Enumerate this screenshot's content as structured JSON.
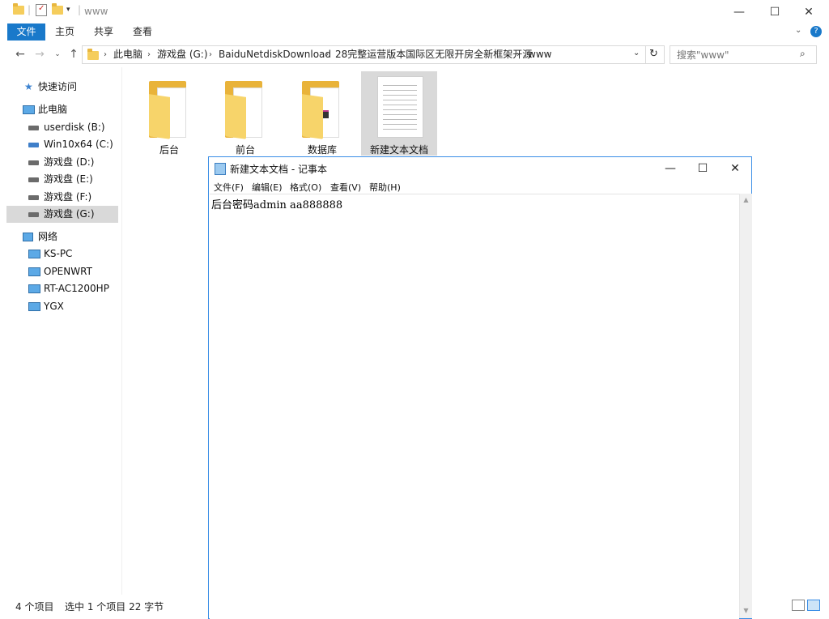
{
  "explorer": {
    "window_title": "www",
    "window_controls": {
      "minimize": "—",
      "maximize": "☐",
      "close": "✕"
    },
    "ribbon_tabs": [
      "文件",
      "主页",
      "共享",
      "查看"
    ],
    "breadcrumbs": [
      "此电脑",
      "游戏盘 (G:)",
      "BaiduNetdiskDownload",
      "28完整运营版本国际区无限开房全新框架开源",
      "www"
    ],
    "search_placeholder": "搜索\"www\"",
    "nav": {
      "quick_access": "快速访问",
      "this_pc": "此电脑",
      "drives": [
        {
          "label": "userdisk (B:)"
        },
        {
          "label": "Win10x64 (C:)"
        },
        {
          "label": "游戏盘 (D:)"
        },
        {
          "label": "游戏盘 (E:)"
        },
        {
          "label": "游戏盘 (F:)"
        },
        {
          "label": "游戏盘 (G:)",
          "selected": true
        }
      ],
      "network": "网络",
      "network_items": [
        "KS-PC",
        "OPENWRT",
        "RT-AC1200HP",
        "YGX"
      ]
    },
    "files": [
      {
        "name": "后台",
        "type": "folder"
      },
      {
        "name": "前台",
        "type": "folder"
      },
      {
        "name": "数据库",
        "type": "folder"
      },
      {
        "name": "新建文本文档",
        "type": "text-file",
        "selected": true
      }
    ],
    "status": {
      "item_count": "4 个项目",
      "selection": "选中 1 个项目  22 字节"
    }
  },
  "notepad": {
    "title": "新建文本文档 - 记事本",
    "menu": [
      "文件(F)",
      "编辑(E)",
      "格式(O)",
      "查看(V)",
      "帮助(H)"
    ],
    "content": "后台密码admin aa888888",
    "controls": {
      "minimize": "—",
      "maximize": "☐",
      "close": "✕"
    }
  },
  "colors": {
    "accent": "#1979ca",
    "selection": "#d9d9d9",
    "folder": "#f5cd5c",
    "notepad_border": "#3a8ee6"
  }
}
